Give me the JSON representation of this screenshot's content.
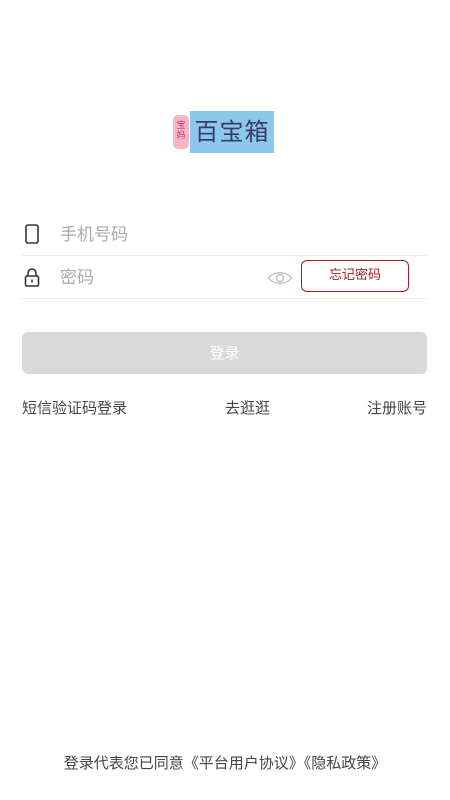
{
  "logo": {
    "badge_text": "宝妈",
    "brand_text": "百宝箱"
  },
  "form": {
    "phone_placeholder": "手机号码",
    "password_placeholder": "密码",
    "forgot_password_label": "忘记密码",
    "login_label": "登录"
  },
  "links": {
    "sms_login": "短信验证码登录",
    "browse": "去逛逛",
    "register": "注册账号"
  },
  "agreement": {
    "prefix": "登录代表您已同意",
    "platform_agreement": "《平台用户协议》",
    "privacy_policy": "《隐私政策》"
  },
  "colors": {
    "accent": "#a51c1c",
    "login_disabled_bg": "#d9d9d9"
  }
}
